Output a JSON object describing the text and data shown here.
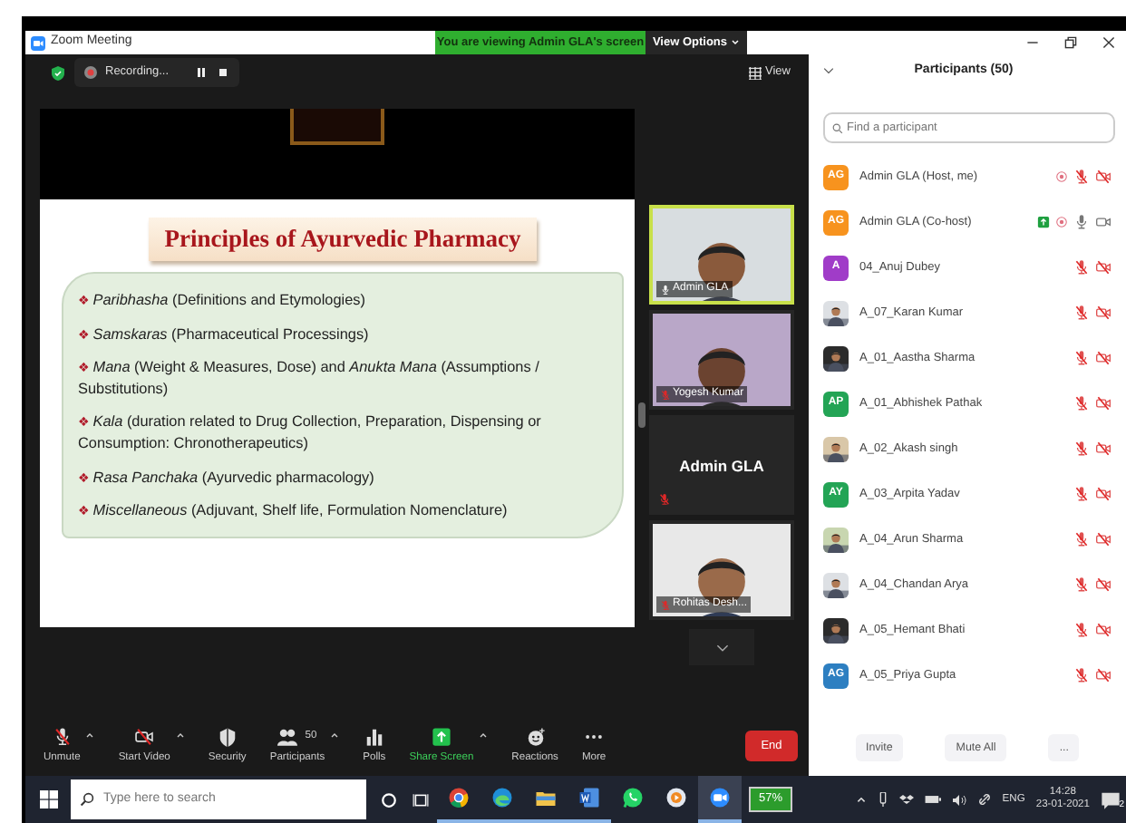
{
  "window": {
    "title": "Zoom Meeting"
  },
  "banner": {
    "text": "You are viewing Admin GLA's screen"
  },
  "view_options": {
    "label": "View Options"
  },
  "recording": {
    "label": "Recording..."
  },
  "view_button": {
    "label": "View"
  },
  "slide": {
    "title": "Principles of Ayurvedic Pharmacy",
    "items": [
      {
        "marker": "❖",
        "text": "*Paribhasha* (Definitions and Etymologies)"
      },
      {
        "marker": "❖",
        "text": "*Samskaras* (Pharmaceutical Processings)"
      },
      {
        "marker": "❖",
        "text": "*Mana* (Weight & Measures, Dose) and *Anukta Mana* (Assumptions / Substitutions)"
      },
      {
        "marker": "❖",
        "text": "*Kala* (duration related to Drug Collection, Preparation, Dispensing or Consumption: Chronotherapeutics)"
      },
      {
        "marker": "❖",
        "text": "*Rasa Panchaka* (Ayurvedic pharmacology)"
      },
      {
        "marker": "❖",
        "text": "*Miscellaneous* (Adjuvant, Shelf life, Formulation Nomenclature)"
      }
    ]
  },
  "video_tiles": [
    {
      "kind": "video",
      "name": "Admin GLA",
      "muted": false,
      "speaking": true
    },
    {
      "kind": "video",
      "name": "Yogesh Kumar",
      "muted": true,
      "speaking": false
    },
    {
      "kind": "name",
      "name": "Admin GLA",
      "muted": true,
      "speaking": false
    },
    {
      "kind": "video",
      "name": "Rohitas Desh...",
      "muted": true,
      "speaking": false
    }
  ],
  "toolbar": [
    {
      "kind": "unmute",
      "label": "Unmute",
      "caret": true
    },
    {
      "kind": "start_video",
      "label": "Start Video",
      "caret": true
    },
    {
      "kind": "security",
      "label": "Security",
      "caret": false
    },
    {
      "kind": "participants",
      "label": "Participants",
      "count": "50",
      "caret": true
    },
    {
      "kind": "polls",
      "label": "Polls",
      "caret": false
    },
    {
      "kind": "share_screen",
      "label": "Share Screen",
      "caret": true
    },
    {
      "kind": "reactions",
      "label": "Reactions",
      "caret": false
    },
    {
      "kind": "more",
      "label": "More",
      "caret": false
    }
  ],
  "end_button": {
    "label": "End"
  },
  "participants": {
    "title": "Participants (50)",
    "search": {
      "placeholder": "Find a participant"
    },
    "rows": [
      {
        "name": "Admin GLA (Host, me)",
        "avatar": {
          "kind": "initials",
          "text": "AG",
          "color": "#f7931e"
        },
        "sharing": false,
        "recording": true,
        "mic_muted": true,
        "video_off": true
      },
      {
        "name": "Admin GLA (Co-host)",
        "avatar": {
          "kind": "initials",
          "text": "AG",
          "color": "#f7931e"
        },
        "sharing": true,
        "recording": true,
        "mic_muted": false,
        "video_off": false
      },
      {
        "name": "04_Anuj Dubey",
        "avatar": {
          "kind": "initials",
          "text": "A",
          "color": "#a03cc8"
        },
        "sharing": false,
        "recording": false,
        "mic_muted": true,
        "video_off": true
      },
      {
        "name": "A_07_Karan Kumar",
        "sharing": false,
        "recording": false,
        "mic_muted": true,
        "video_off": true
      },
      {
        "name": "A_01_Aastha Sharma",
        "sharing": false,
        "recording": false,
        "mic_muted": true,
        "video_off": true
      },
      {
        "name": "A_01_Abhishek Pathak",
        "avatar": {
          "kind": "initials",
          "text": "AP",
          "color": "#23a455"
        },
        "sharing": false,
        "recording": false,
        "mic_muted": true,
        "video_off": true
      },
      {
        "name": "A_02_Akash singh",
        "sharing": false,
        "recording": false,
        "mic_muted": true,
        "video_off": true
      },
      {
        "name": "A_03_Arpita Yadav",
        "avatar": {
          "kind": "initials",
          "text": "AY",
          "color": "#23a455"
        },
        "sharing": false,
        "recording": false,
        "mic_muted": true,
        "video_off": true
      },
      {
        "name": "A_04_Arun Sharma",
        "sharing": false,
        "recording": false,
        "mic_muted": true,
        "video_off": true
      },
      {
        "name": "A_04_Chandan Arya",
        "sharing": false,
        "recording": false,
        "mic_muted": true,
        "video_off": true
      },
      {
        "name": "A_05_Hemant Bhati",
        "sharing": false,
        "recording": false,
        "mic_muted": true,
        "video_off": true
      },
      {
        "name": "A_05_Priya Gupta",
        "avatar": {
          "kind": "initials",
          "text": "AG",
          "color": "#2d7fc1"
        },
        "sharing": false,
        "recording": false,
        "mic_muted": true,
        "video_off": true
      }
    ],
    "buttons": [
      "Invite",
      "Mute All",
      "..."
    ]
  },
  "taskbar": {
    "search": {
      "placeholder": "Type here to search"
    },
    "apps": [
      {
        "kind": "chrome",
        "running": true,
        "selected": false
      },
      {
        "kind": "edge",
        "running": true,
        "selected": false
      },
      {
        "kind": "files",
        "running": true,
        "selected": false
      },
      {
        "kind": "word",
        "running": true,
        "selected": false
      },
      {
        "kind": "whatsapp",
        "running": false,
        "selected": false
      },
      {
        "kind": "media",
        "running": false,
        "selected": false
      },
      {
        "kind": "zoom",
        "running": true,
        "selected": true
      }
    ],
    "battery": "57%",
    "language": "ENG",
    "time": "14:28",
    "date": "23-01-2021",
    "notifications": "2"
  }
}
